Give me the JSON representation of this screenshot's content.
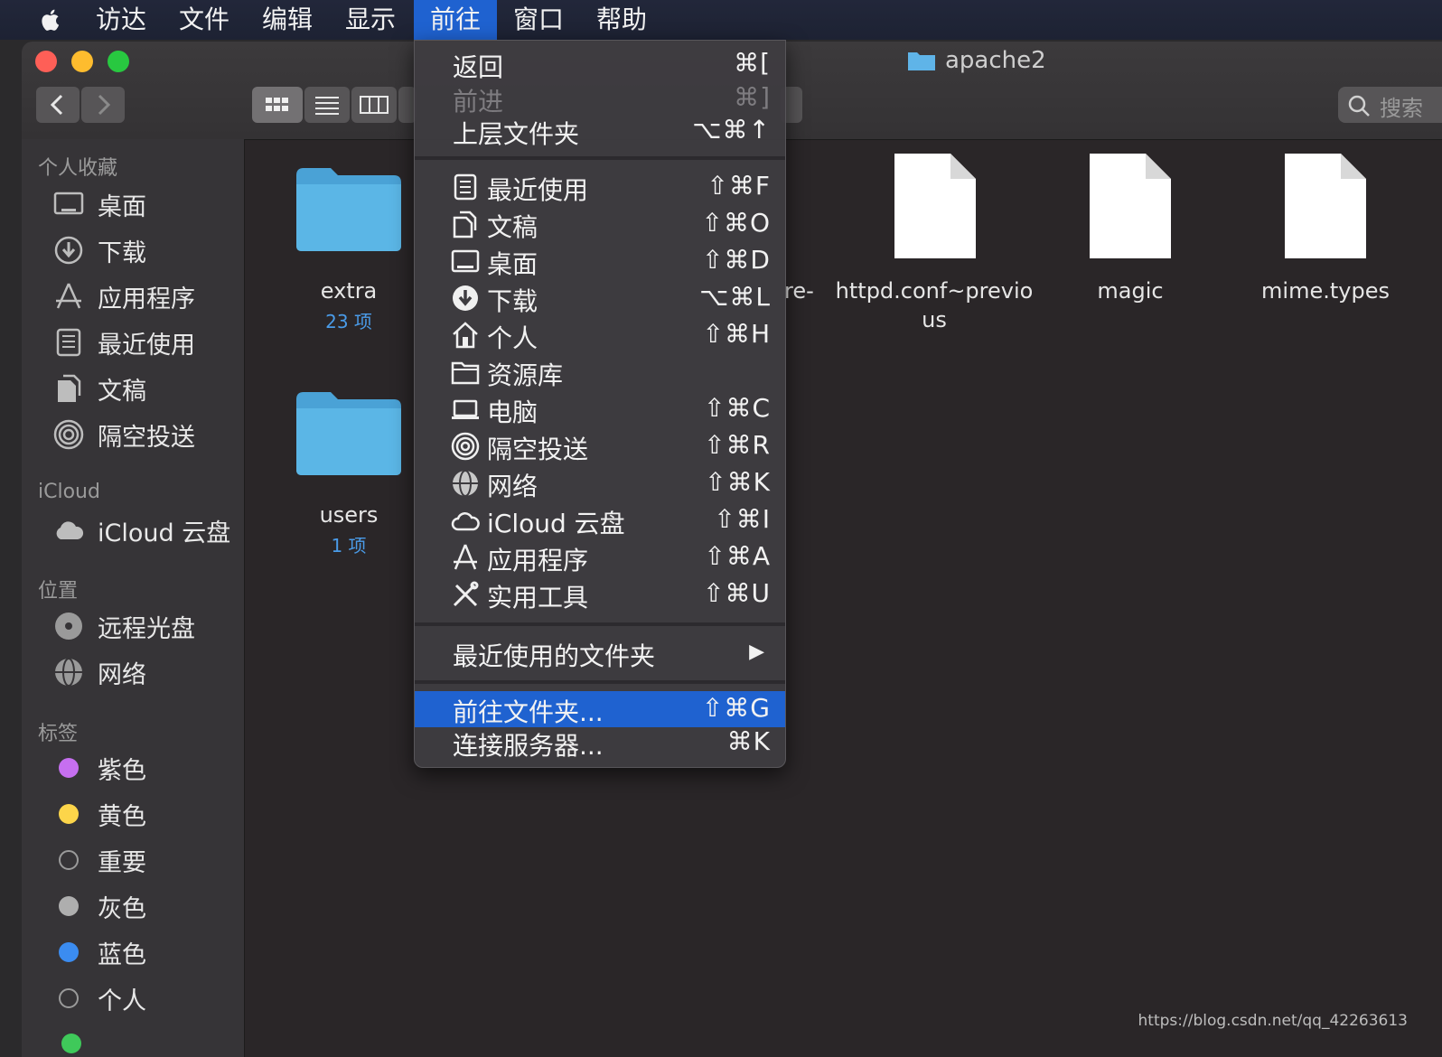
{
  "menubar": {
    "items": [
      "访达",
      "文件",
      "编辑",
      "显示",
      "前往",
      "窗口",
      "帮助"
    ],
    "active": "前往"
  },
  "window": {
    "title": "apache2",
    "search_placeholder": "搜索"
  },
  "sidebar": {
    "favorites_header": "个人收藏",
    "favorites": [
      "桌面",
      "下载",
      "应用程序",
      "最近使用",
      "文稿",
      "隔空投送"
    ],
    "icloud_header": "iCloud",
    "icloud": [
      "iCloud 云盘"
    ],
    "locations_header": "位置",
    "locations": [
      "远程光盘",
      "网络"
    ],
    "tags_header": "标签",
    "tags": [
      {
        "label": "紫色",
        "color": "#c66ff0"
      },
      {
        "label": "黄色",
        "color": "#fcd54a"
      },
      {
        "label": "重要",
        "color": ""
      },
      {
        "label": "灰色",
        "color": "#aeaeae"
      },
      {
        "label": "蓝色",
        "color": "#3b8cf0"
      },
      {
        "label": "个人",
        "color": ""
      }
    ]
  },
  "files": [
    {
      "name": "extra",
      "sub": "23 项",
      "kind": "folder"
    },
    {
      "name": "users",
      "sub": "1 项",
      "kind": "folder"
    },
    {
      "name": "re-",
      "kind": "partial"
    },
    {
      "name": "httpd.conf~previo",
      "name2": "us",
      "kind": "file"
    },
    {
      "name": "magic",
      "kind": "file"
    },
    {
      "name": "mime.types",
      "kind": "file"
    }
  ],
  "go_menu": {
    "back": {
      "label": "返回",
      "shortcut": "⌘["
    },
    "forward": {
      "label": "前进",
      "shortcut": "⌘]"
    },
    "enclosing": {
      "label": "上层文件夹",
      "shortcut": "⌥⌘↑"
    },
    "places": [
      {
        "label": "最近使用",
        "shortcut": "⇧⌘F",
        "icon": "recents-icon"
      },
      {
        "label": "文稿",
        "shortcut": "⇧⌘O",
        "icon": "documents-icon"
      },
      {
        "label": "桌面",
        "shortcut": "⇧⌘D",
        "icon": "desktop-icon"
      },
      {
        "label": "下载",
        "shortcut": "⌥⌘L",
        "icon": "downloads-icon"
      },
      {
        "label": "个人",
        "shortcut": "⇧⌘H",
        "icon": "home-icon"
      },
      {
        "label": "资源库",
        "shortcut": "",
        "icon": "library-folder-icon"
      },
      {
        "label": "电脑",
        "shortcut": "⇧⌘C",
        "icon": "computer-icon"
      },
      {
        "label": "隔空投送",
        "shortcut": "⇧⌘R",
        "icon": "airdrop-icon"
      },
      {
        "label": "网络",
        "shortcut": "⇧⌘K",
        "icon": "network-icon"
      },
      {
        "label": "iCloud 云盘",
        "shortcut": "⇧⌘I",
        "icon": "icloud-icon"
      },
      {
        "label": "应用程序",
        "shortcut": "⇧⌘A",
        "icon": "applications-icon"
      },
      {
        "label": "实用工具",
        "shortcut": "⇧⌘U",
        "icon": "utilities-icon"
      }
    ],
    "recent_folders": {
      "label": "最近使用的文件夹",
      "arrow": "▶"
    },
    "go_to_folder": {
      "label": "前往文件夹...",
      "shortcut": "⇧⌘G"
    },
    "connect_server": {
      "label": "连接服务器...",
      "shortcut": "⌘K"
    }
  },
  "watermark": "https://blog.csdn.net/qq_42263613"
}
